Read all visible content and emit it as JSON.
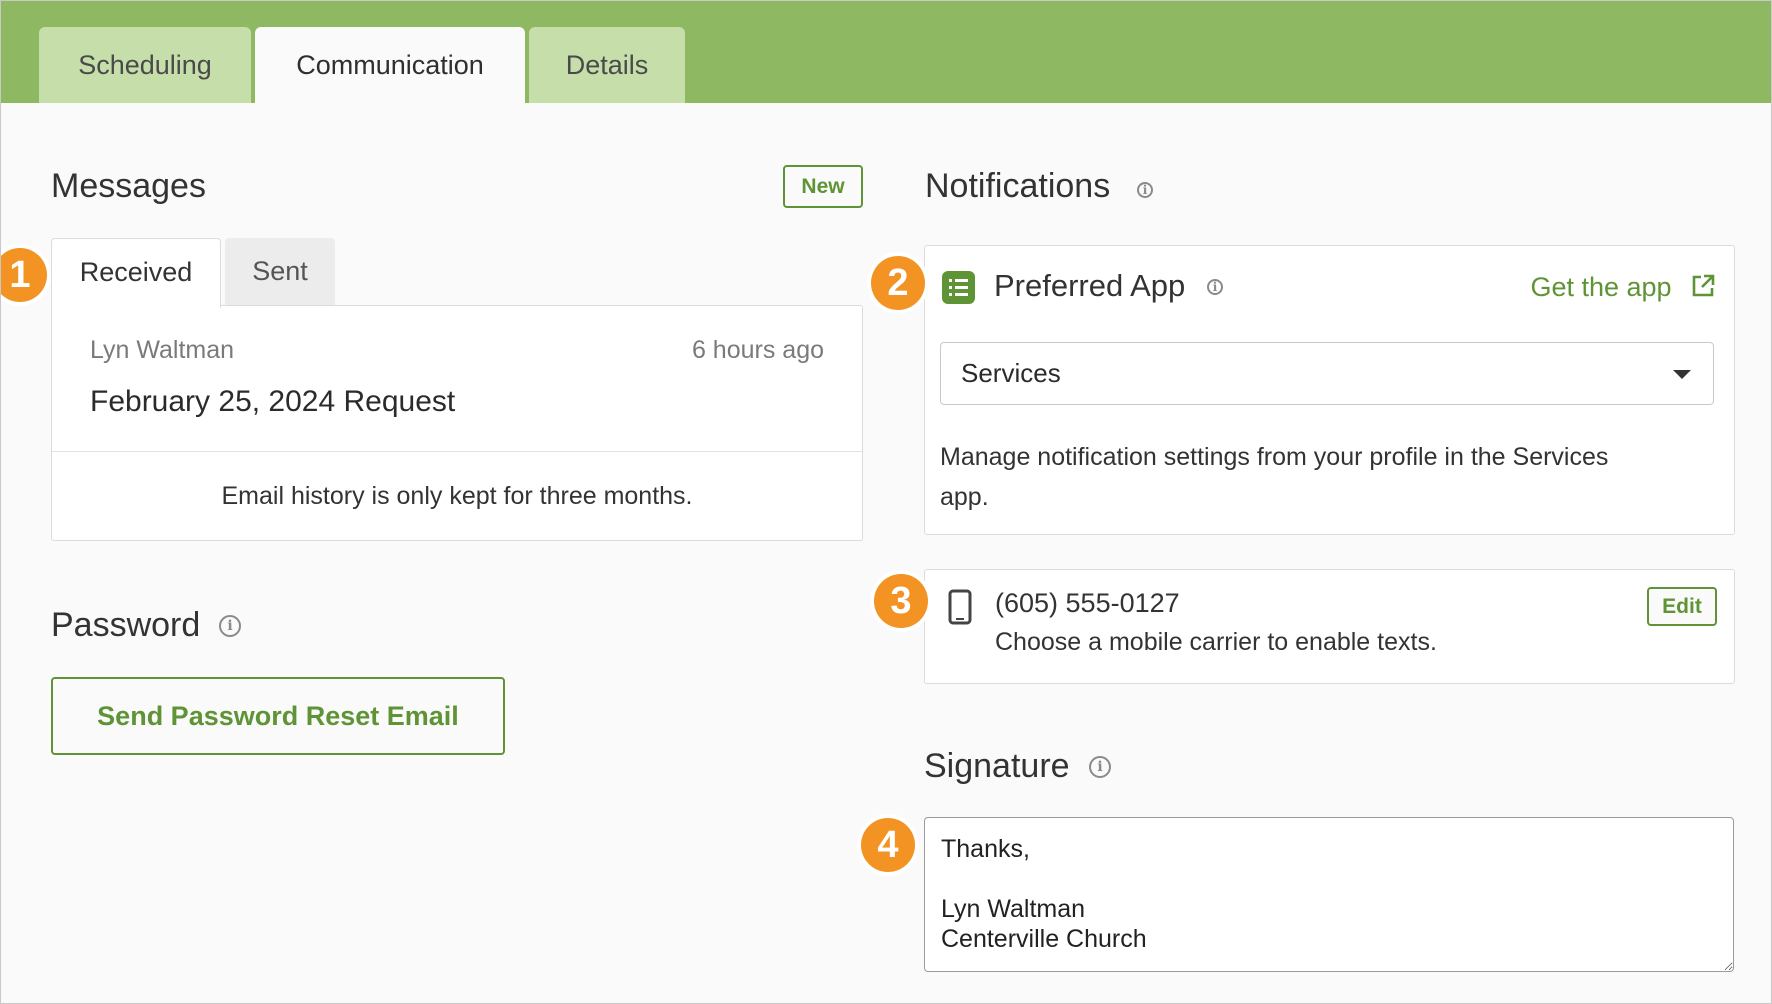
{
  "tabs": {
    "scheduling": "Scheduling",
    "communication": "Communication",
    "details": "Details"
  },
  "messages": {
    "title": "Messages",
    "new_label": "New",
    "tabs": {
      "received": "Received",
      "sent": "Sent"
    },
    "item": {
      "sender": "Lyn Waltman",
      "time": "6 hours ago",
      "subject": "February 25, 2024 Request"
    },
    "note": "Email history is only kept for three months."
  },
  "password": {
    "title": "Password",
    "reset_button": "Send Password Reset Email"
  },
  "notifications": {
    "title": "Notifications",
    "preferred_app": {
      "title": "Preferred App",
      "get_app_label": "Get the app",
      "selected_app": "Services",
      "description": "Manage notification settings from your profile in the Services app."
    },
    "phone": {
      "number": "(605) 555-0127",
      "note": "Choose a mobile carrier to enable texts.",
      "edit_label": "Edit"
    }
  },
  "signature": {
    "title": "Signature",
    "value": "Thanks,\n\nLyn Waltman\nCenterville Church"
  },
  "callouts": [
    "1",
    "2",
    "3",
    "4"
  ],
  "icons": {
    "info": "info-icon",
    "app": "list-app-icon",
    "external": "external-link-icon",
    "phone": "mobile-phone-icon"
  },
  "colors": {
    "header_green": "#8fb862",
    "tab_inactive": "#c5deaa",
    "accent_green": "#5f9436",
    "callout_orange": "#f39324"
  }
}
